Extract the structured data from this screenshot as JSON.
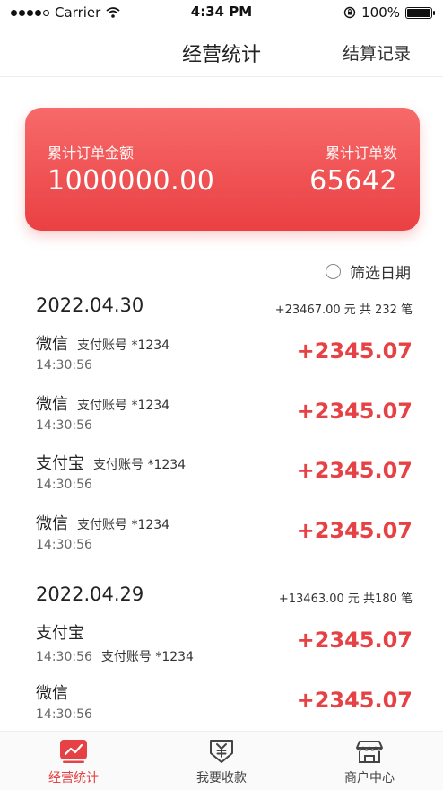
{
  "status_bar": {
    "carrier": "Carrier",
    "time": "4:34 PM",
    "battery": "100%"
  },
  "nav": {
    "title": "经营统计",
    "right_label": "结算记录"
  },
  "summary": {
    "amount_label": "累计订单金额",
    "amount_value": "1000000.00",
    "count_label": "累计订单数",
    "count_value": "65642"
  },
  "filter": {
    "label": "筛选日期"
  },
  "days": [
    {
      "date": "2022.04.30",
      "summary": "+23467.00 元  共 232 笔",
      "records": [
        {
          "channel": "微信",
          "account": "支付账号 *1234",
          "time": "14:30:56",
          "amount": "+2345.07"
        },
        {
          "channel": "微信",
          "account": "支付账号 *1234",
          "time": "14:30:56",
          "amount": "+2345.07"
        },
        {
          "channel": "支付宝",
          "account": "支付账号 *1234",
          "time": "14:30:56",
          "amount": "+2345.07"
        },
        {
          "channel": "微信",
          "account": "支付账号 *1234",
          "time": "14:30:56",
          "amount": "+2345.07"
        }
      ]
    },
    {
      "date": "2022.04.29",
      "summary": "+13463.00 元  共180 笔",
      "records": [
        {
          "channel": "支付宝",
          "account": "支付账号 *1234",
          "time": "14:30:56",
          "amount": "+2345.07",
          "account_on_time_line": true
        },
        {
          "channel": "微信",
          "account": "",
          "time": "14:30:56",
          "amount": "+2345.07"
        }
      ]
    }
  ],
  "tabs": [
    {
      "label": "经营统计",
      "icon": "stats-chart-icon",
      "active": true
    },
    {
      "label": "我要收款",
      "icon": "receive-money-icon",
      "active": false
    },
    {
      "label": "商户中心",
      "icon": "store-icon",
      "active": false
    }
  ],
  "colors": {
    "accent": "#e64245",
    "card_top": "#f76a6a",
    "card_bottom": "#ea4043"
  }
}
